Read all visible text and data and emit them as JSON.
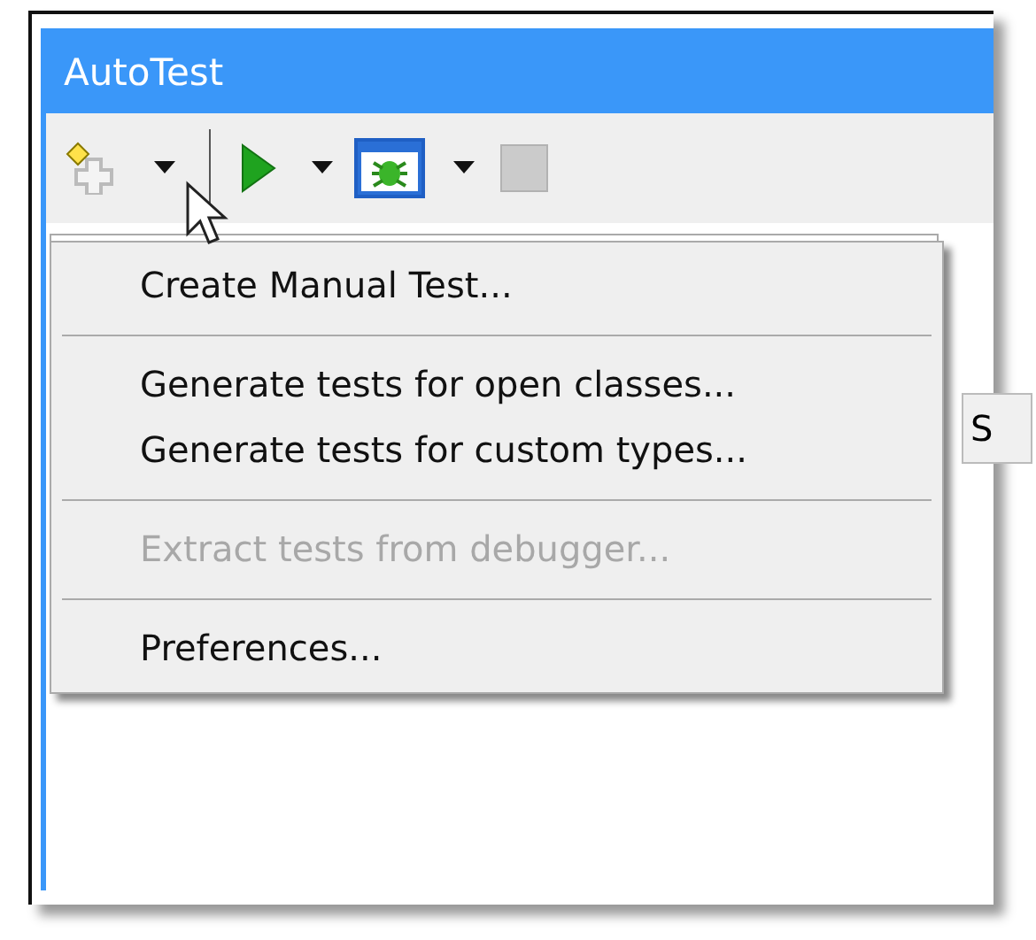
{
  "window": {
    "title": "AutoTest"
  },
  "toolbar": [
    {
      "kind": "new",
      "dropdown": true,
      "disabled": false,
      "highlighted": false
    },
    {
      "kind": "divider"
    },
    {
      "kind": "run",
      "dropdown": true,
      "disabled": false,
      "highlighted": false
    },
    {
      "kind": "debug",
      "dropdown": true,
      "disabled": false,
      "highlighted": true
    },
    {
      "kind": "stop",
      "dropdown": false,
      "disabled": true,
      "highlighted": false
    }
  ],
  "side_button": {
    "label": "S"
  },
  "menu": [
    {
      "kind": "item",
      "label": "Create Manual Test...",
      "disabled": false
    },
    {
      "kind": "separator"
    },
    {
      "kind": "item",
      "label": "Generate tests for open classes...",
      "disabled": false
    },
    {
      "kind": "item",
      "label": "Generate tests for custom types...",
      "disabled": false
    },
    {
      "kind": "separator"
    },
    {
      "kind": "item",
      "label": "Extract tests from debugger...",
      "disabled": true
    },
    {
      "kind": "separator"
    },
    {
      "kind": "item",
      "label": "Preferences...",
      "disabled": false
    }
  ]
}
